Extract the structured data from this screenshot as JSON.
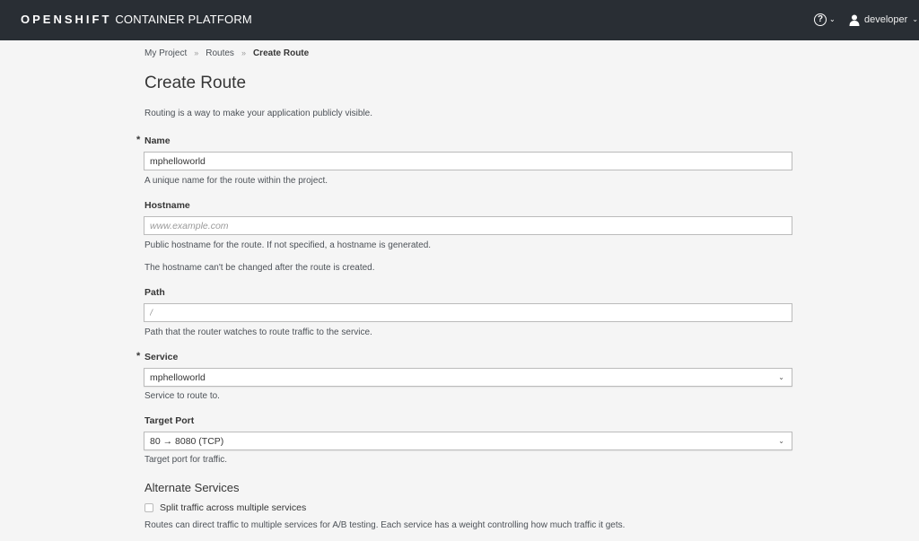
{
  "header": {
    "brand_bold": "OPENSHIFT",
    "brand_rest": "CONTAINER PLATFORM",
    "help_icon_glyph": "?",
    "user_label": "developer"
  },
  "breadcrumb": {
    "items": [
      "My Project",
      "Routes",
      "Create Route"
    ],
    "separator": "»"
  },
  "page": {
    "title": "Create Route",
    "intro": "Routing is a way to make your application publicly visible."
  },
  "form": {
    "required_marker": "*",
    "name": {
      "label": "Name",
      "value": "mphelloworld",
      "help": "A unique name for the route within the project."
    },
    "hostname": {
      "label": "Hostname",
      "placeholder": "www.example.com",
      "help": "Public hostname for the route. If not specified, a hostname is generated.",
      "help2": "The hostname can't be changed after the route is created."
    },
    "path": {
      "label": "Path",
      "placeholder": "/",
      "help": "Path that the router watches to route traffic to the service."
    },
    "service": {
      "label": "Service",
      "selected": "mphelloworld",
      "help": "Service to route to."
    },
    "target_port": {
      "label": "Target Port",
      "selected": "80 → 8080 (TCP)",
      "help": "Target port for traffic."
    },
    "alternate_services": {
      "title": "Alternate Services",
      "checkbox_label": "Split traffic across multiple services",
      "help": "Routes can direct traffic to multiple services for A/B testing. Each service has a weight controlling how much traffic it gets."
    }
  },
  "icons": {
    "help": "help-circle-icon",
    "user": "user-icon",
    "dropdown": "chevron-down-icon"
  },
  "colors": {
    "topbar": "#292e34",
    "page_background": "#f5f5f5"
  }
}
